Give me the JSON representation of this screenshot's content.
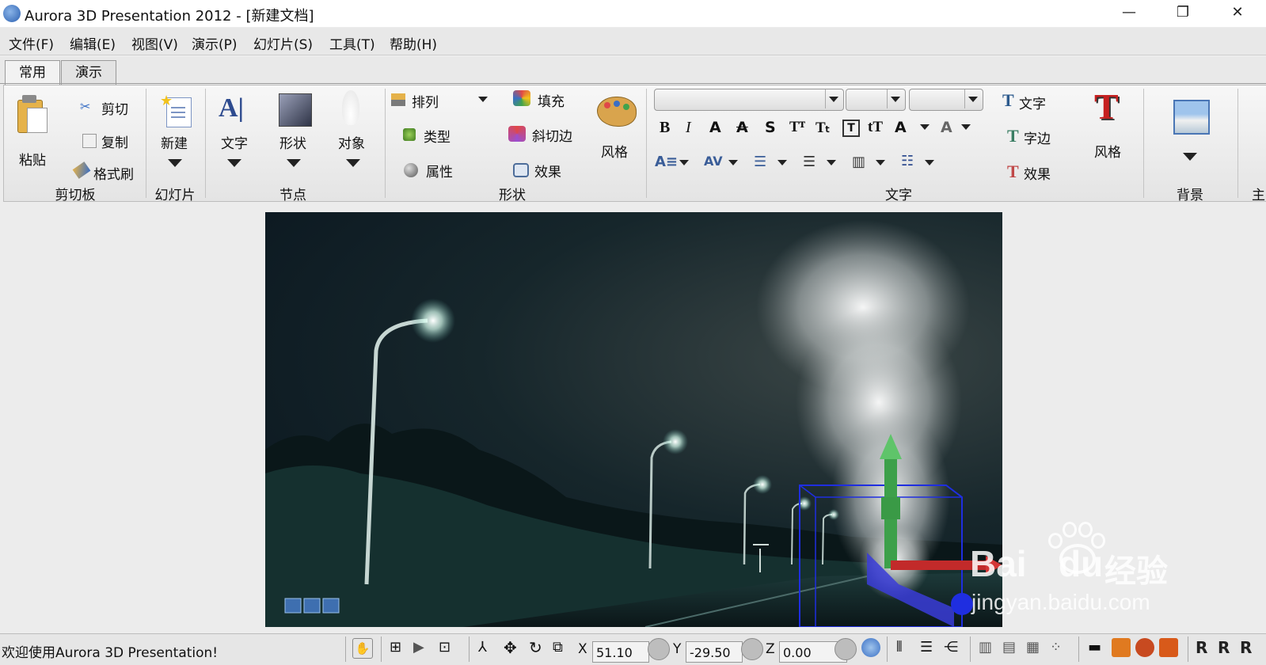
{
  "window": {
    "title": "Aurora 3D Presentation 2012 - [新建文档]",
    "minimize": "—",
    "maximize": "❐",
    "close": "✕"
  },
  "menu": [
    "文件(F)",
    "编辑(E)",
    "视图(V)",
    "演示(P)",
    "幻灯片(S)",
    "工具(T)",
    "帮助(H)"
  ],
  "tabs": [
    "常用",
    "演示"
  ],
  "ribbon": {
    "clipboard": {
      "paste": "粘贴",
      "cut": "剪切",
      "copy": "复制",
      "format_painter": "格式刷",
      "group": "剪切板"
    },
    "slide": {
      "new": "新建",
      "group": "幻灯片"
    },
    "nodes": {
      "text": "文字",
      "shape": "形状",
      "object": "对象",
      "group": "节点"
    },
    "shape": {
      "arrange": "排列",
      "type": "类型",
      "property": "属性",
      "fill": "填充",
      "bevel": "斜切边",
      "effect": "效果",
      "style": "风格",
      "group": "形状"
    },
    "text": {
      "bold": "B",
      "italic": "I",
      "text_btn": "文字",
      "stroke_btn": "字边",
      "effect_btn": "效果",
      "style": "风格",
      "group": "文字"
    },
    "background": {
      "group": "背景"
    },
    "more": {
      "group": "主"
    }
  },
  "statusbar": {
    "message": "欢迎使用Aurora 3D Presentation!",
    "x_label": "X",
    "x_value": "51.10",
    "y_label": "Y",
    "y_value": "-29.50",
    "z_label": "Z",
    "z_value": "0.00"
  },
  "watermark": {
    "brand": "Bai",
    "brand2": "du",
    "cn": "经验",
    "url": "jingyan.baidu.com"
  }
}
